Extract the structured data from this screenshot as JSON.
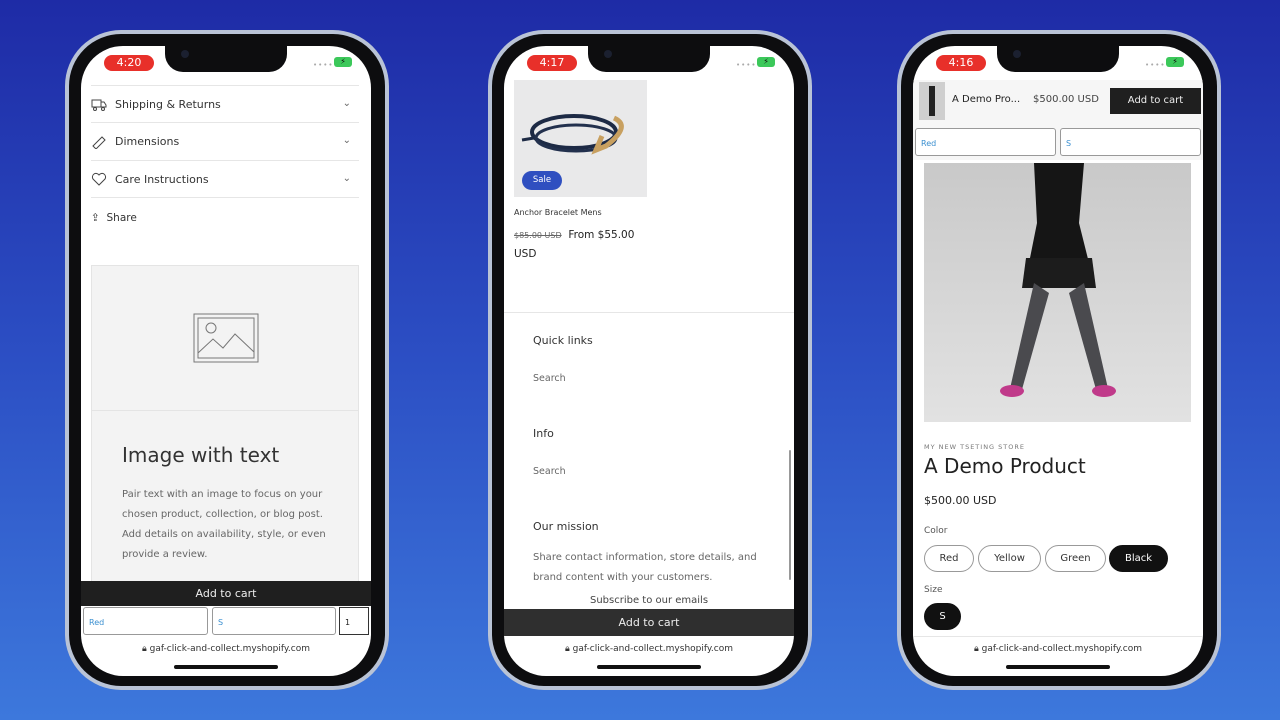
{
  "phones": [
    {
      "time": "4:20",
      "url": "gaf-click-and-collect.myshopify.com",
      "accordion": [
        {
          "label": "Shipping & Returns",
          "icon": "truck-icon"
        },
        {
          "label": "Dimensions",
          "icon": "ruler-icon"
        },
        {
          "label": "Care Instructions",
          "icon": "heart-icon"
        }
      ],
      "share": "Share",
      "image_with_text": {
        "heading": "Image with text",
        "body": "Pair text with an image to focus on your chosen product, collection, or blog post. Add details on availability, style, or even provide a review."
      },
      "add_to_cart": "Add to cart",
      "color_select": "Red",
      "size_select": "S",
      "quantity": "1"
    },
    {
      "time": "4:17",
      "url": "gaf-click-and-collect.myshopify.com",
      "product": {
        "badge": "Sale",
        "title": "Anchor Bracelet Mens",
        "compare_price": "$85.00 USD",
        "price": "From $55.00 USD"
      },
      "footer": {
        "quick_links": "Quick links",
        "quick_links_item": "Search",
        "info": "Info",
        "info_item": "Search",
        "mission": "Our mission",
        "mission_text": "Share contact information, store details, and brand content with your customers.",
        "subscribe": "Subscribe to our emails"
      },
      "add_to_cart": "Add to cart"
    },
    {
      "time": "4:16",
      "url": "gaf-click-and-collect.myshopify.com",
      "sticky": {
        "name": "A Demo Pro...",
        "price": "$500.00 USD",
        "button": "Add to cart",
        "color_select": "Red",
        "size_select": "S"
      },
      "vendor": "MY NEW TSETING STORE",
      "title": "A Demo Product",
      "price": "$500.00 USD",
      "color_label": "Color",
      "colors": [
        "Red",
        "Yellow",
        "Green",
        "Black"
      ],
      "selected_color": "Black",
      "size_label": "Size",
      "sizes": [
        "S"
      ]
    }
  ],
  "colors": {
    "accent_sale": "#2f4fc0",
    "button": "#1f1f1f",
    "time_pill": "#e8302a",
    "link": "#3a8fd0"
  }
}
